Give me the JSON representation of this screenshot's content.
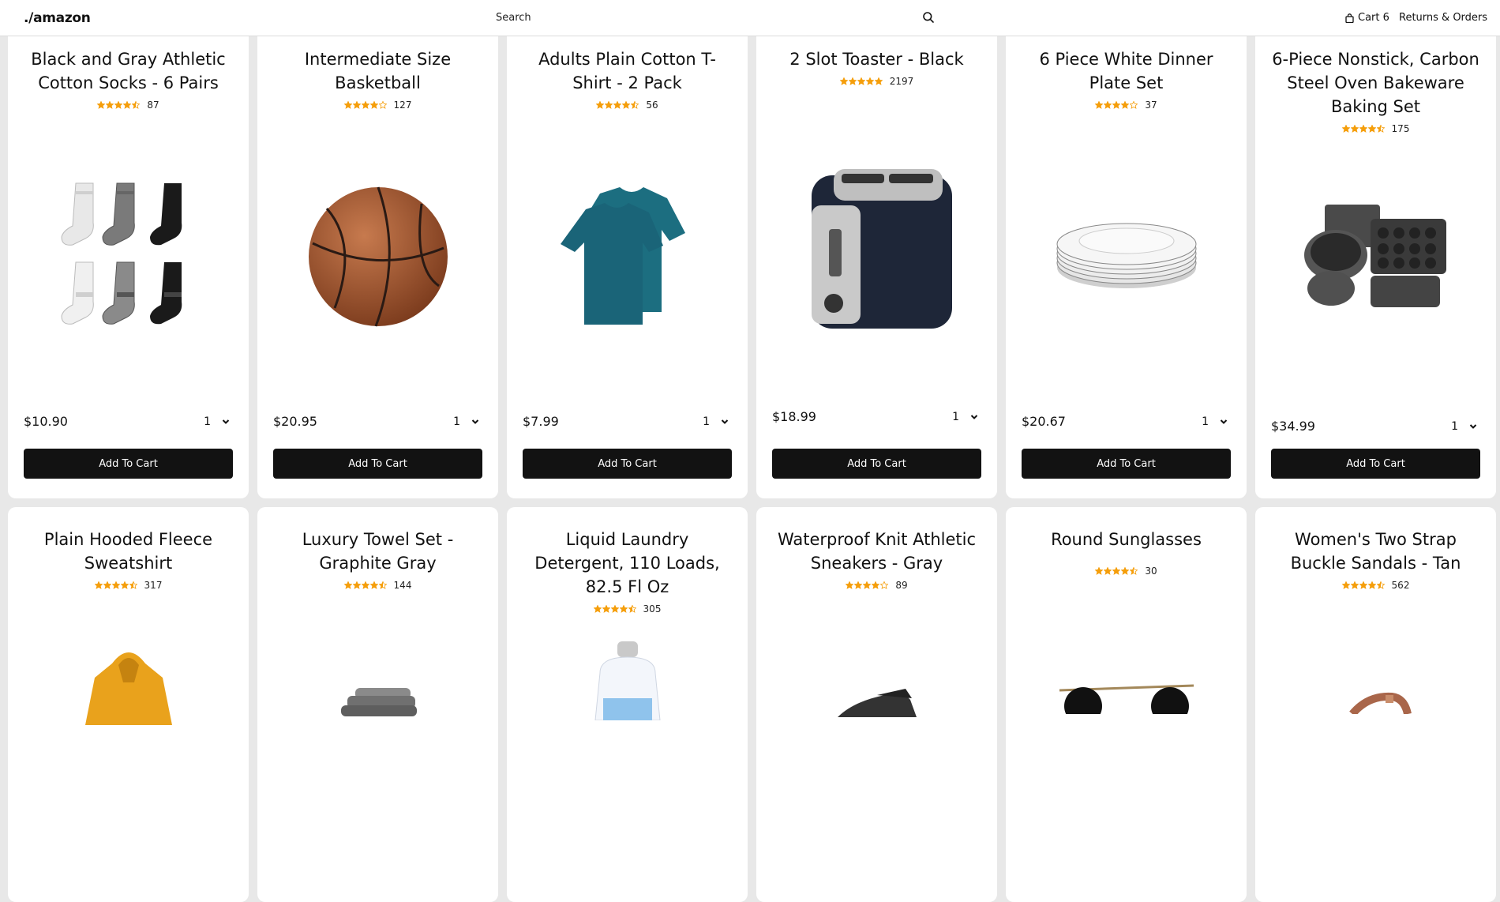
{
  "header": {
    "logo": "./amazon",
    "search_placeholder": "Search",
    "cart_label": "Cart 6",
    "returns_label": "Returns & Orders"
  },
  "add_to_cart_label": "Add To Cart",
  "products": [
    {
      "title": "Black and Gray Athletic Cotton Socks - 6 Pairs",
      "rating": 4.5,
      "reviews": "87",
      "price": "$10.90",
      "qty": "1"
    },
    {
      "title": "Intermediate Size Basketball",
      "rating": 4.0,
      "reviews": "127",
      "price": "$20.95",
      "qty": "1"
    },
    {
      "title": "Adults Plain Cotton T-Shirt - 2 Pack",
      "rating": 4.5,
      "reviews": "56",
      "price": "$7.99",
      "qty": "1"
    },
    {
      "title": "2 Slot Toaster - Black",
      "rating": 5.0,
      "reviews": "2197",
      "price": "$18.99",
      "qty": "1"
    },
    {
      "title": "6 Piece White Dinner Plate Set",
      "rating": 4.0,
      "reviews": "37",
      "price": "$20.67",
      "qty": "1"
    },
    {
      "title": "6-Piece Nonstick, Carbon Steel Oven Bakeware Baking Set",
      "rating": 4.5,
      "reviews": "175",
      "price": "$34.99",
      "qty": "1"
    },
    {
      "title": "Plain Hooded Fleece Sweatshirt",
      "rating": 4.5,
      "reviews": "317"
    },
    {
      "title": "Luxury Towel Set - Graphite Gray",
      "rating": 4.5,
      "reviews": "144"
    },
    {
      "title": "Liquid Laundry Detergent, 110 Loads, 82.5 Fl Oz",
      "rating": 4.5,
      "reviews": "305"
    },
    {
      "title": "Waterproof Knit Athletic Sneakers - Gray",
      "rating": 4.0,
      "reviews": "89"
    },
    {
      "title": "Round Sunglasses",
      "rating": 4.5,
      "reviews": "30"
    },
    {
      "title": "Women's Two Strap Buckle Sandals - Tan",
      "rating": 4.5,
      "reviews": "562"
    }
  ]
}
